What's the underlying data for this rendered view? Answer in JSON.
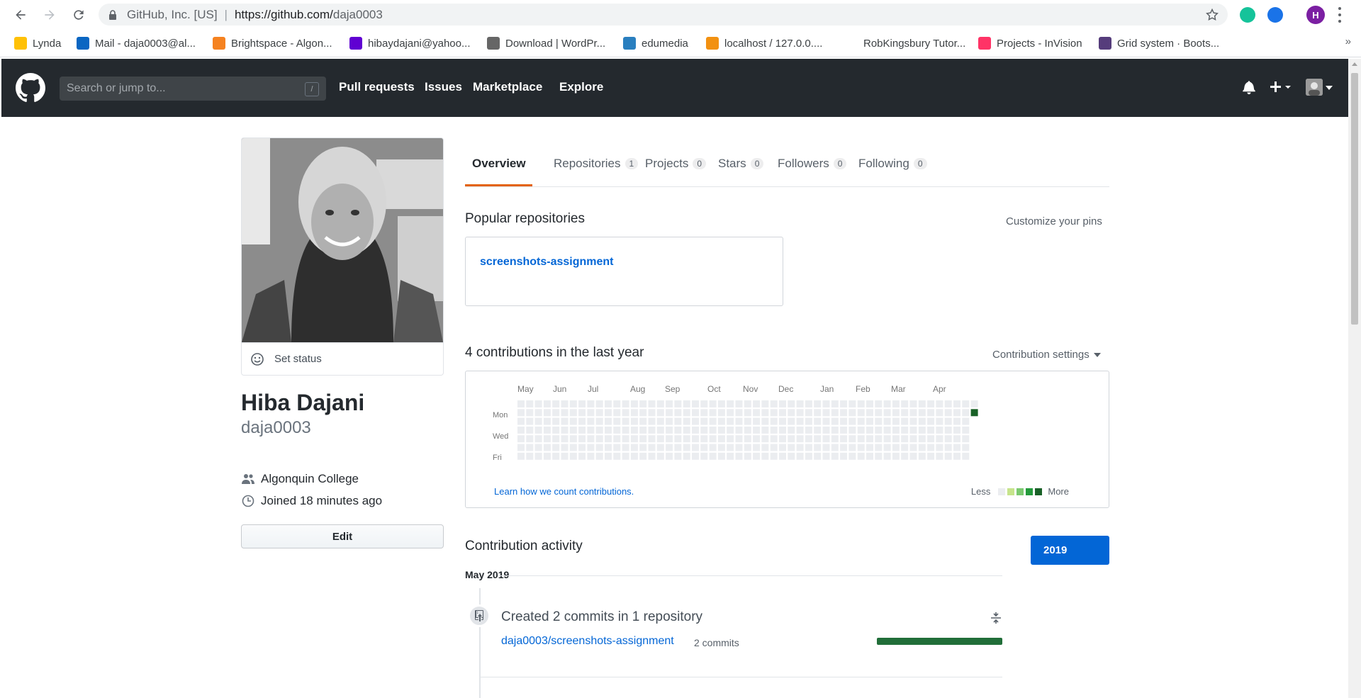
{
  "browser": {
    "site_name": "GitHub, Inc. [US]",
    "url_host": "https://github.com/",
    "url_path": "daja0003",
    "profile_initial": "H",
    "bookmarks": [
      {
        "label": "Lynda",
        "icon": "lynda-icon",
        "color": "#ffc107"
      },
      {
        "label": "Mail - daja0003@al...",
        "icon": "outlook-icon",
        "color": "#0a66c2"
      },
      {
        "label": "Brightspace - Algon...",
        "icon": "brightspace-icon",
        "color": "#f58220"
      },
      {
        "label": "hibaydajani@yahoo...",
        "icon": "yahoo-mail-icon",
        "color": "#6001d2"
      },
      {
        "label": "Download | WordPr...",
        "icon": "wordpress-icon",
        "color": "#666666"
      },
      {
        "label": "edumedia",
        "icon": "edumedia-icon",
        "color": "#2a7fbf"
      },
      {
        "label": "localhost / 127.0.0....",
        "icon": "phpmyadmin-icon",
        "color": "#f29111"
      },
      {
        "label": "RobKingsbury Tutor...",
        "icon": "",
        "color": ""
      },
      {
        "label": "Projects - InVision",
        "icon": "invision-icon",
        "color": "#ff3366"
      },
      {
        "label": "Grid system · Boots...",
        "icon": "bootstrap-icon",
        "color": "#563d7c"
      }
    ],
    "more": "»"
  },
  "github": {
    "search_placeholder": "Search or jump to...",
    "search_shortcut": "/",
    "nav": [
      "Pull requests",
      "Issues",
      "Marketplace",
      "Explore"
    ]
  },
  "profile": {
    "set_status": "Set status",
    "name": "Hiba Dajani",
    "login": "daja0003",
    "organization": "Algonquin College",
    "joined": "Joined 18 minutes ago",
    "edit_label": "Edit"
  },
  "tabs": [
    {
      "label": "Overview",
      "count": null,
      "active": true
    },
    {
      "label": "Repositories",
      "count": "1"
    },
    {
      "label": "Projects",
      "count": "0"
    },
    {
      "label": "Stars",
      "count": "0"
    },
    {
      "label": "Followers",
      "count": "0"
    },
    {
      "label": "Following",
      "count": "0"
    }
  ],
  "popular": {
    "title": "Popular repositories",
    "customize": "Customize your pins",
    "repo": "screenshots-assignment"
  },
  "contributions": {
    "title": "4 contributions in the last year",
    "settings": "Contribution settings",
    "months": [
      "May",
      "Jun",
      "Jul",
      "Aug",
      "Sep",
      "Oct",
      "Nov",
      "Dec",
      "Jan",
      "Feb",
      "Mar",
      "Apr"
    ],
    "days": [
      "Mon",
      "Wed",
      "Fri"
    ],
    "learn": "Learn how we count contributions.",
    "less": "Less",
    "more": "More",
    "weeks": 53,
    "last_week_days": 2,
    "active_cell": {
      "week": 53,
      "day": 1,
      "level": 4
    },
    "colors": [
      "#ebedf0",
      "#c6e48b",
      "#7bc96f",
      "#239a3b",
      "#196127"
    ]
  },
  "activity": {
    "title": "Contribution activity",
    "year": "2019",
    "month": "May 2019",
    "item_title": "Created 2 commits in 1 repository",
    "repo": "daja0003/screenshots-assignment",
    "commits": "2 commits",
    "bar_fraction": 1.0
  }
}
